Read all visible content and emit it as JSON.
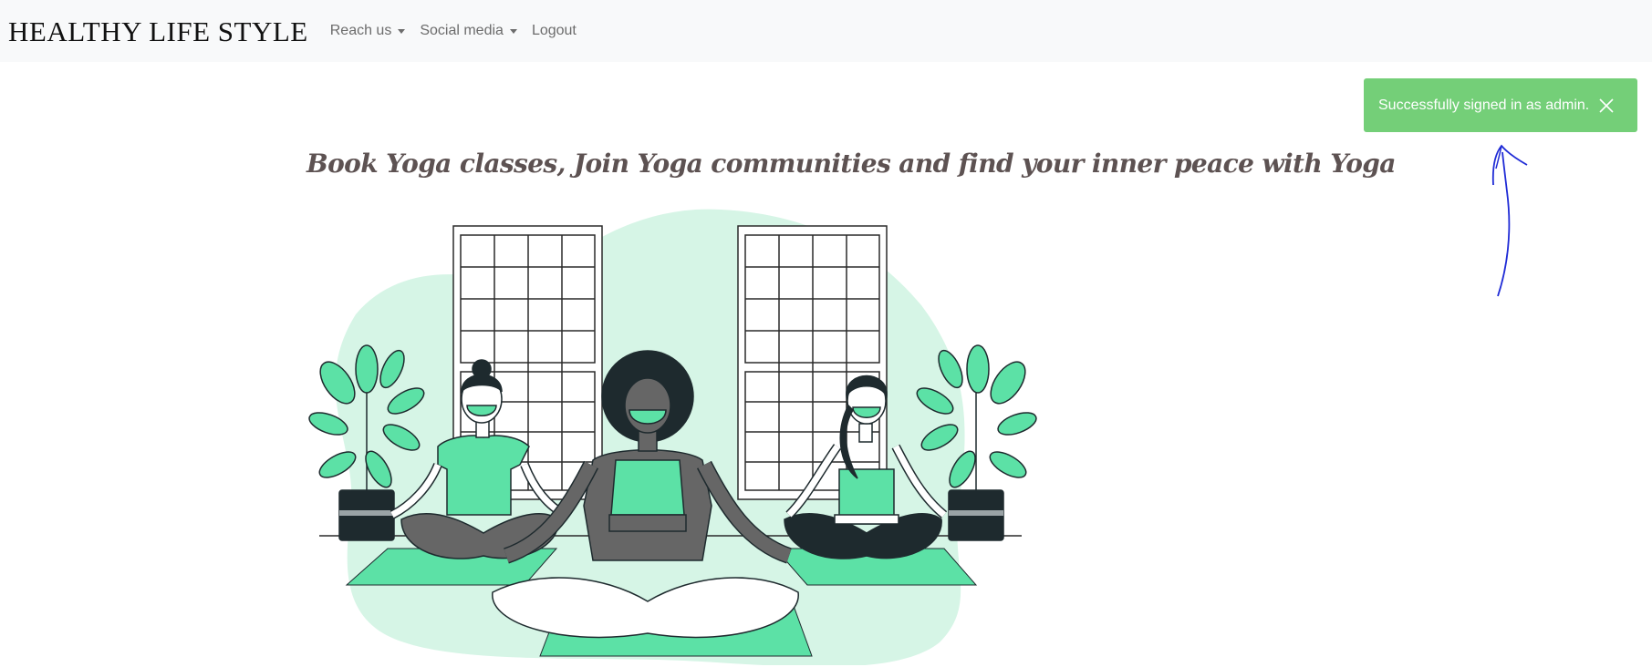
{
  "navbar": {
    "brand": "HEALTHY LIFE STYLE",
    "items": [
      {
        "label": "Reach us",
        "dropdown": true
      },
      {
        "label": "Social media",
        "dropdown": true
      },
      {
        "label": "Logout",
        "dropdown": false
      }
    ],
    "background": "#f8f9fa"
  },
  "toast": {
    "message": "Successfully signed in as admin.",
    "close_icon": "close-icon",
    "color": "#74cf78"
  },
  "annotation": {
    "icon": "hand-drawn-arrow-up",
    "color": "#1f2bd6"
  },
  "main": {
    "headline": "Book Yoga classes, Join Yoga communities and find your inner peace with Yoga",
    "illustration": "yoga-meditation-illustration",
    "accent": "#5ce1a6"
  }
}
